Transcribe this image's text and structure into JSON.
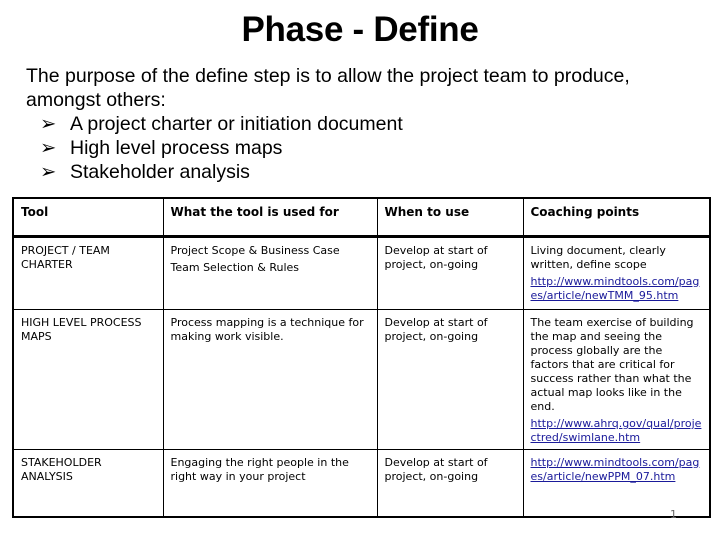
{
  "title": "Phase - Define",
  "intro": {
    "paragraph": "The purpose of the define step is to allow the project team to produce, amongst others:",
    "bullet_icon": "arrow-bullet-icon",
    "bullet_glyph": "➢",
    "bullets": [
      "A project charter or initiation document",
      "High level process maps",
      "Stakeholder analysis"
    ]
  },
  "table": {
    "headers": [
      "Tool",
      "What the tool is used for",
      "When to use",
      "Coaching points"
    ],
    "rows": [
      {
        "tool": [
          "PROJECT / TEAM",
          "CHARTER"
        ],
        "used_for": [
          "Project Scope & Business Case",
          "Team Selection & Rules"
        ],
        "when": "Develop at start of project, on-going",
        "coaching": "Living document, clearly written, define scope",
        "link": "http://www.mindtools.com/pages/article/newTMM_95.htm"
      },
      {
        "tool": [
          "HIGH LEVEL PROCESS",
          "MAPS"
        ],
        "used_for": [
          "Process mapping is a technique for making work visible."
        ],
        "when": "Develop at start of project, on-going",
        "coaching": "The team exercise of building the map and seeing the process globally are the factors that are critical for success rather than what the actual map looks like in the end.",
        "link": "http://www.ahrq.gov/qual/projectred/swimlane.htm"
      },
      {
        "tool": [
          "STAKEHOLDER",
          "ANALYSIS"
        ],
        "used_for": [
          "Engaging the right people in the right way in your project"
        ],
        "when": "Develop at start of project, on-going",
        "coaching": "",
        "link": "http://www.mindtools.com/pages/article/newPPM_07.htm"
      }
    ]
  },
  "page_number": "1",
  "colors": {
    "link": "#1a1a9a",
    "page_number": "#666666"
  }
}
